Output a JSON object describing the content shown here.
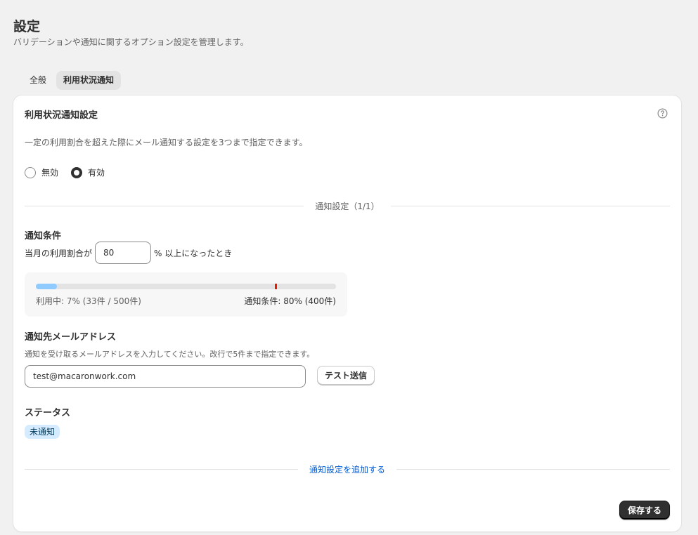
{
  "page": {
    "title": "設定",
    "subtitle": "バリデーションや通知に関するオプション設定を管理します。"
  },
  "tabs": [
    {
      "label": "全般",
      "active": false
    },
    {
      "label": "利用状況通知",
      "active": true
    }
  ],
  "card": {
    "title": "利用状況通知設定",
    "help_icon": "question-circle-icon",
    "description": "一定の利用割合を超えた際にメール通知する設定を3つまで指定できます。",
    "radio": {
      "options": [
        "無効",
        "有効"
      ],
      "selected": "有効"
    },
    "divider_label": "通知設定（1/1）",
    "condition": {
      "title": "通知条件",
      "prefix": "当月の利用割合が",
      "value": "80",
      "suffix": "% 以上になったとき"
    },
    "usage": {
      "used_percent": 7,
      "threshold_percent": 80,
      "left_label": "利用中: 7% (33件 / 500件)",
      "right_label": "通知条件: 80% (400件)"
    },
    "email": {
      "title": "通知先メールアドレス",
      "description": "通知を受け取るメールアドレスを入力してください。改行で5件まで指定できます。",
      "value": "test@macaronwork.com",
      "test_button": "テスト送信"
    },
    "status": {
      "title": "ステータス",
      "badge": "未通知"
    },
    "add_link": "通知設定を追加する",
    "save_button": "保存する"
  },
  "colors": {
    "primary_button": "#303030",
    "link": "#005bd3",
    "progress_fill": "#8fcbff",
    "threshold_marker": "#e51c00",
    "badge_bg": "#d5ebff"
  }
}
